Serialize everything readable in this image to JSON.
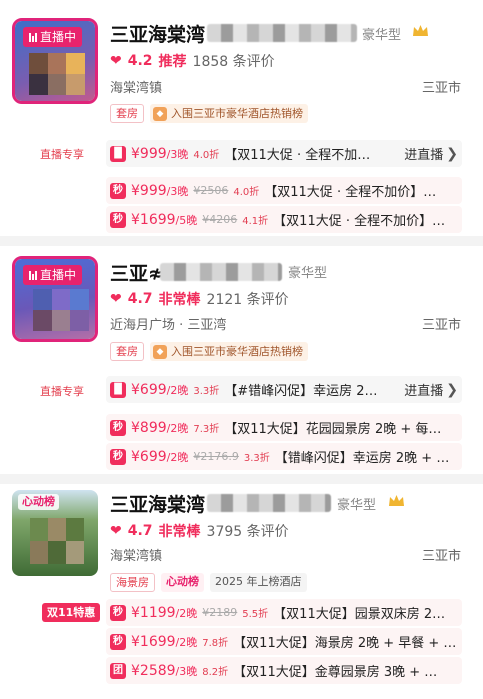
{
  "hotels": [
    {
      "thumb_tag": "直播中",
      "name": "三亚海棠湾",
      "star": "豪华型",
      "rating_score": "4.2",
      "rating_grade": "推荐",
      "reviews": "1858 条评价",
      "location": "海棠湾镇",
      "city": "三亚市",
      "tags": [
        "套房",
        "入围三亚市豪华酒店热销榜"
      ],
      "stream_label": "直播专享",
      "deals": [
        {
          "badge": "live",
          "price": "¥999",
          "nights": "/3晚",
          "orig": "",
          "discount": "4.0折",
          "desc": "【双11大促 · 全程不加…",
          "action": "进直播"
        },
        {
          "badge": "秒",
          "price": "¥999",
          "nights": "/3晚",
          "orig": "¥2506",
          "discount": "4.0折",
          "desc": "【双11大促 · 全程不加价】…",
          "action": ""
        },
        {
          "badge": "秒",
          "price": "¥1699",
          "nights": "/5晚",
          "orig": "¥4206",
          "discount": "4.1折",
          "desc": "【双11大促 · 全程不加价】…",
          "action": ""
        }
      ]
    },
    {
      "thumb_tag": "直播中",
      "name": "三亚≉",
      "star": "豪华型",
      "rating_score": "4.7",
      "rating_grade": "非常棒",
      "reviews": "2121 条评价",
      "location": "近海月广场 · 三亚湾",
      "city": "三亚市",
      "tags": [
        "套房",
        "入围三亚市豪华酒店热销榜"
      ],
      "stream_label": "直播专享",
      "deals": [
        {
          "badge": "live",
          "price": "¥699",
          "nights": "/2晚",
          "orig": "",
          "discount": "3.3折",
          "desc": "【#错峰闪促】幸运房 2…",
          "action": "进直播"
        },
        {
          "badge": "秒",
          "price": "¥899",
          "nights": "/2晚",
          "orig": "",
          "discount": "7.3折",
          "desc": "【双11大促】花园园景房 2晚 + 每…",
          "action": ""
        },
        {
          "badge": "秒",
          "price": "¥699",
          "nights": "/2晚",
          "orig": "¥2176.9",
          "discount": "3.3折",
          "desc": "【错峰闪促】幸运房 2晚 + …",
          "action": ""
        }
      ]
    },
    {
      "thumb_tag": "心动榜",
      "name": "三亚海棠湾",
      "star": "豪华型",
      "rating_score": "4.7",
      "rating_grade": "非常棒",
      "reviews": "3795 条评价",
      "location": "海棠湾镇",
      "city": "三亚市",
      "tags": [
        "海景房",
        "心动榜",
        "2025 年上榜酒店"
      ],
      "stream_label": "双11特惠",
      "deals": [
        {
          "badge": "秒",
          "price": "¥1199",
          "nights": "/2晚",
          "orig": "¥2189",
          "discount": "5.5折",
          "desc": "【双11大促】园景双床房 2…",
          "action": ""
        },
        {
          "badge": "秒",
          "price": "¥1699",
          "nights": "/2晚",
          "orig": "",
          "discount": "7.8折",
          "desc": "【双11大促】海景房 2晚 + 早餐 + …",
          "action": ""
        },
        {
          "badge": "团",
          "price": "¥2589",
          "nights": "/3晚",
          "orig": "",
          "discount": "8.2折",
          "desc": "【双11大促】金尊园景房 3晚 + …",
          "action": ""
        }
      ]
    }
  ],
  "colors": {
    "accent": "#f02d5c",
    "live_border": "#e0247a",
    "rank_bg": "#fdf1e6"
  }
}
